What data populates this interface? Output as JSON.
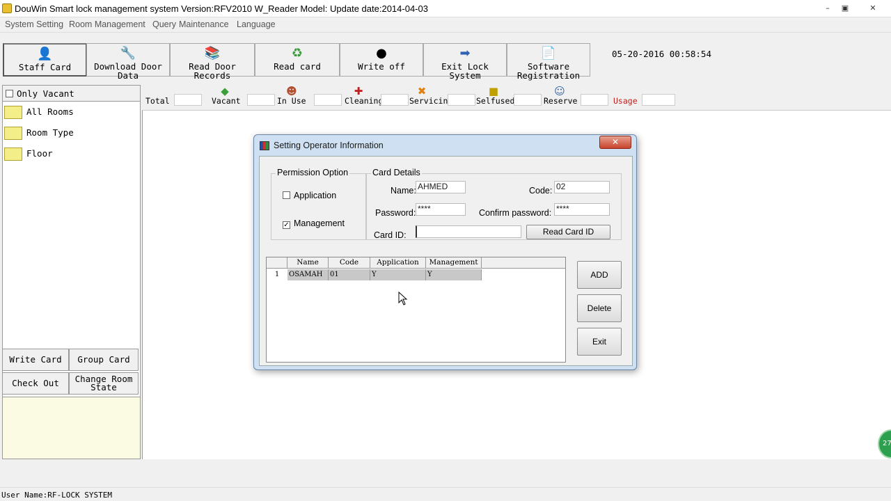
{
  "window": {
    "title": "DouWin Smart lock management system  Version:RFV2010 W_Reader Model: Update date:2014-04-03",
    "min": "–",
    "max": "▣",
    "close": "✕"
  },
  "menu": [
    "System Setting",
    "Room Management",
    "Query",
    "Maintenance",
    "Language"
  ],
  "toolbar": {
    "buttons": [
      {
        "line1": "",
        "line2": "Staff Card",
        "icon": "staff-card-icon",
        "glyph": "👤"
      },
      {
        "line1": "Download Door",
        "line2": "Data",
        "icon": "download-door-data-icon",
        "glyph": "🔧"
      },
      {
        "line1": "Read Door",
        "line2": "Records",
        "icon": "read-door-records-icon",
        "glyph": "📚"
      },
      {
        "line1": "",
        "line2": "Read card",
        "icon": "read-card-icon",
        "glyph": "♻"
      },
      {
        "line1": "",
        "line2": "Write off",
        "icon": "write-off-icon",
        "glyph": "●"
      },
      {
        "line1": "",
        "line2": "Exit Lock System",
        "icon": "exit-arrow-icon",
        "glyph": "➡"
      },
      {
        "line1": "Software",
        "line2": "Registration",
        "icon": "registration-icon",
        "glyph": "📄"
      }
    ],
    "datetime": "05-20-2016 00:58:54"
  },
  "left_panel": {
    "only_vacant": "Only Vacant",
    "tree": [
      "All Rooms",
      "Room Type",
      "Floor"
    ],
    "buttons": {
      "write_card": "Write Card",
      "group_card": "Group Card",
      "check_out": "Check Out",
      "change_room_state_1": "Change Room",
      "change_room_state_2": "State"
    }
  },
  "status_row": {
    "total": "Total",
    "vacant": "Vacant",
    "in_use": "In Use",
    "cleaning": "Cleaning",
    "servicing": "Servicing",
    "selfused": "Selfused",
    "reserve": "Reserve",
    "usage": "Usage"
  },
  "statusbar": {
    "user": "User Name:RF-LOCK SYSTEM"
  },
  "dialog": {
    "title": "Setting Operator Information",
    "close": "✕",
    "permission": {
      "legend": "Permission Option",
      "application": "Application",
      "application_checked": false,
      "management": "Management",
      "management_checked": true
    },
    "card": {
      "legend": "Card Details",
      "name_label": "Name:",
      "name_value": "AHMED",
      "code_label": "Code:",
      "code_value": "02",
      "password_label": "Password:",
      "password_value": "****",
      "confirm_label": "Confirm password:",
      "confirm_value": "****",
      "cardid_label": "Card ID:",
      "cardid_value": "",
      "read_button": "Read Card ID"
    },
    "grid": {
      "columns": [
        "Name",
        "Code",
        "Application",
        "Management"
      ],
      "rows": [
        {
          "num": "1",
          "name": "OSAMAH",
          "code": "01",
          "application": "Y",
          "management": "Y"
        }
      ]
    },
    "buttons": {
      "add": "ADD",
      "delete": "Delete",
      "exit": "Exit"
    }
  },
  "overlay_badge": "27"
}
